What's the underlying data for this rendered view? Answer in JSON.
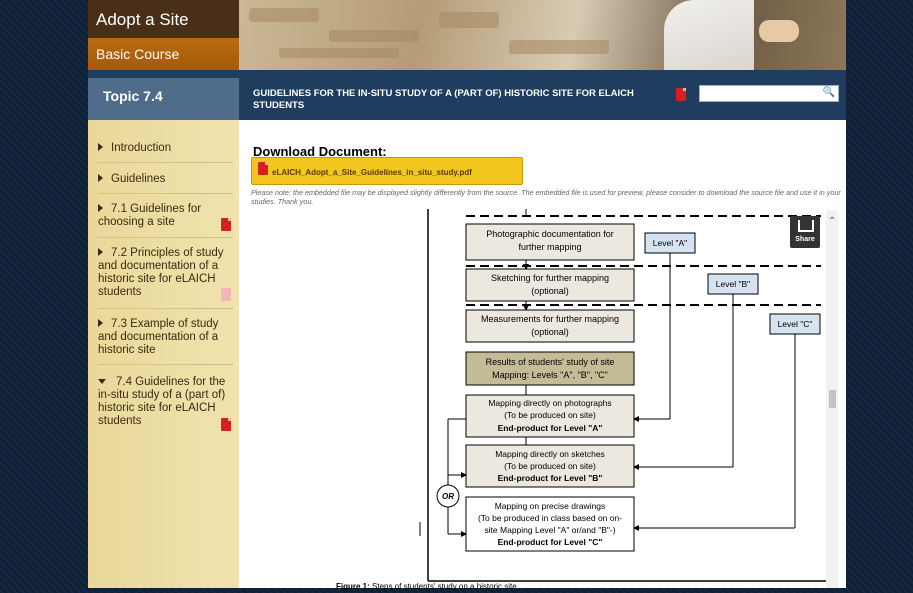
{
  "header": {
    "site_title": "Adopt a Site",
    "course_label": "Basic Course",
    "topic_label": "Topic 7.4",
    "document_title": "GUIDELINES FOR THE IN-SITU STUDY OF A (PART OF) HISTORIC SITE FOR ELAICH STUDENTS",
    "search_placeholder": ""
  },
  "sidebar": {
    "items": [
      {
        "label": "Introduction"
      },
      {
        "label": "Guidelines"
      },
      {
        "label": "7.1 Guidelines for choosing a site"
      },
      {
        "label": "7.2 Principles of study and documentation of a historic site for eLAICH students"
      },
      {
        "label": "7.3 Example of study and documentation of a historic site"
      },
      {
        "label": "7.4 Guidelines for the in-situ study of a (part of) historic site for eLAICH students"
      }
    ]
  },
  "download": {
    "heading": "Download Document:",
    "file_name": "eLAICH_Adopt_a_Site_Guidelines_in_situ_study.pdf",
    "note": "Please note: the embedded file may be displayed slightly differently from the source. The embedded file is used for preview, please consider to download the source file and use it in your studies. Thank you."
  },
  "viewer": {
    "share_label": "Share",
    "diagram": {
      "box1": [
        "Photographic documentation for",
        "further mapping"
      ],
      "box2": [
        "Sketching for further mapping",
        "(optional)"
      ],
      "box3": [
        "Measurements for further mapping",
        "(optional)"
      ],
      "box4": [
        "Results of students' study of site",
        "Mapping: Levels \"A\", \"B\", \"C\""
      ],
      "box5": [
        "Mapping directly on photographs",
        "(To be produced on site)",
        "End-product for Level \"A\""
      ],
      "box6": [
        "Mapping directly on sketches",
        "(To be produced on site)",
        "End-product for Level \"B\""
      ],
      "box7": [
        "Mapping on precise drawings",
        "(To be produced in class based on on-",
        "site Mapping Level \"A\" or/and \"B\"-)",
        "End-product for Level \"C\""
      ],
      "level_a": "Level \"A\"",
      "level_b": "Level \"B\"",
      "level_c": "Level \"C\"",
      "or_label": "OR"
    },
    "caption_bold": "Figure 1:",
    "caption_text": " Steps of students' study on a historic site"
  },
  "colors": {
    "header_dark": "#1f3d5f",
    "course_orange": "#b86b12",
    "sidebar_bg": "#f0e3ae",
    "download_button": "#f2c51f",
    "pdf_red": "#d42020"
  }
}
